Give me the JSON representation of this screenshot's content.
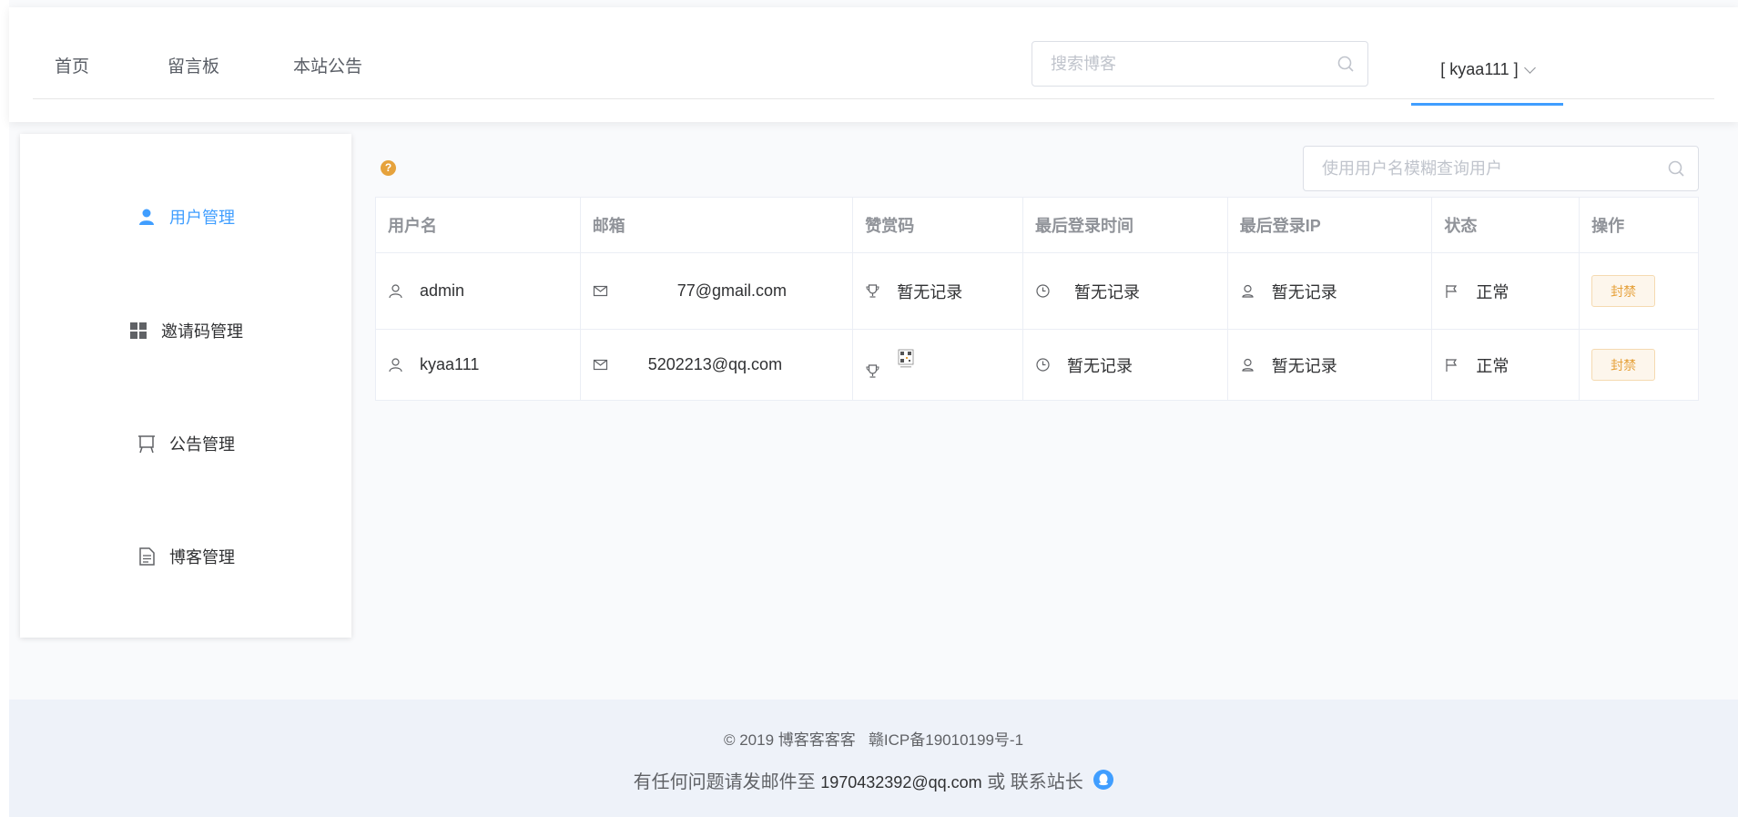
{
  "header": {
    "nav": [
      "首页",
      "留言板",
      "本站公告"
    ],
    "search_placeholder": "搜索博客",
    "user": "[ kyaa111 ]"
  },
  "sidebar": {
    "items": [
      {
        "label": "用户管理",
        "icon": "user-icon",
        "active": true
      },
      {
        "label": "邀请码管理",
        "icon": "grid-icon",
        "active": false
      },
      {
        "label": "公告管理",
        "icon": "board-icon",
        "active": false
      },
      {
        "label": "博客管理",
        "icon": "document-icon",
        "active": false
      }
    ]
  },
  "main": {
    "help_icon": "?",
    "user_search_placeholder": "使用用户名模糊查询用户",
    "table": {
      "columns": [
        "用户名",
        "邮箱",
        "赞赏码",
        "最后登录时间",
        "最后登录IP",
        "状态",
        "操作"
      ],
      "rows": [
        {
          "username": "admin",
          "email": "77@gmail.com",
          "reward": "暂无记录",
          "last_login_time": "暂无记录",
          "last_login_ip": "暂无记录",
          "status": "正常",
          "action": "封禁"
        },
        {
          "username": "kyaa111",
          "email": "5202213@qq.com",
          "reward": "",
          "last_login_time": "暂无记录",
          "last_login_ip": "暂无记录",
          "status": "正常",
          "action": "封禁"
        }
      ]
    }
  },
  "footer": {
    "copyright": "© 2019 博客客客客",
    "icp": "赣ICP备19010199号-1",
    "contact_prefix": "有任何问题请发邮件至",
    "contact_email": "1970432392@qq.com",
    "contact_or": "或 联系站长"
  },
  "colors": {
    "accent": "#409eff",
    "warning": "#e6a23c",
    "footer_bg": "#eef2f9"
  }
}
